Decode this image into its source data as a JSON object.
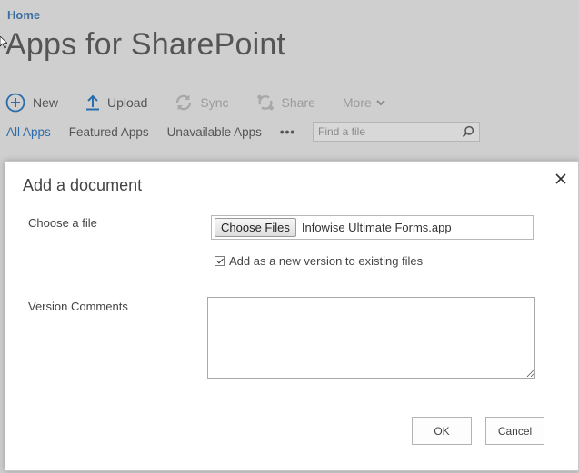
{
  "breadcrumb": {
    "home": "Home"
  },
  "page": {
    "title": "Apps for SharePoint"
  },
  "toolbar": {
    "new_label": "New",
    "upload_label": "Upload",
    "sync_label": "Sync",
    "share_label": "Share",
    "more_label": "More"
  },
  "tabs": [
    {
      "label": "All Apps",
      "active": true
    },
    {
      "label": "Featured Apps",
      "active": false
    },
    {
      "label": "Unavailable Apps",
      "active": false
    }
  ],
  "tabs_more": "•••",
  "search": {
    "placeholder": "Find a file"
  },
  "dialog": {
    "title": "Add a document",
    "choose_file_label": "Choose a file",
    "choose_files_button": "Choose Files",
    "selected_file": "Infowise Ultimate Forms.app",
    "add_version_label": "Add as a new version to existing files",
    "add_version_checked": true,
    "version_comments_label": "Version Comments",
    "version_comments_value": "",
    "ok_label": "OK",
    "cancel_label": "Cancel"
  },
  "colors": {
    "accent": "#2b6cad",
    "overlay": "#cfcfcf",
    "breadcrumb": "#3f6f9f"
  },
  "icons": [
    "plus-circle-icon",
    "upload-arrow-icon",
    "sync-icon",
    "share-icon",
    "chevron-down-icon",
    "search-icon",
    "close-icon",
    "cursor-icon"
  ]
}
